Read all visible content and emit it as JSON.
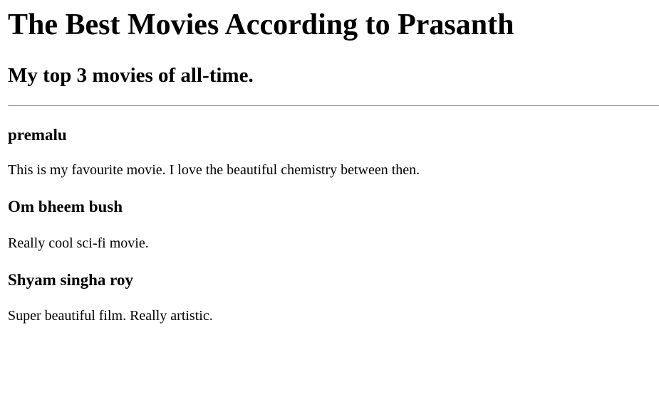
{
  "page": {
    "title": "The Best Movies According to Prasanth",
    "subtitle": "My top 3 movies of all-time."
  },
  "movies": [
    {
      "name": "premalu",
      "description": "This is my favourite movie. I love the beautiful chemistry between then."
    },
    {
      "name": "Om bheem bush",
      "description": "Really cool sci-fi movie."
    },
    {
      "name": "Shyam singha roy",
      "description": "Super beautiful film. Really artistic."
    }
  ],
  "colors": {
    "background": "#ffffff",
    "text": "#000000",
    "divider": "#9a9a9a"
  }
}
